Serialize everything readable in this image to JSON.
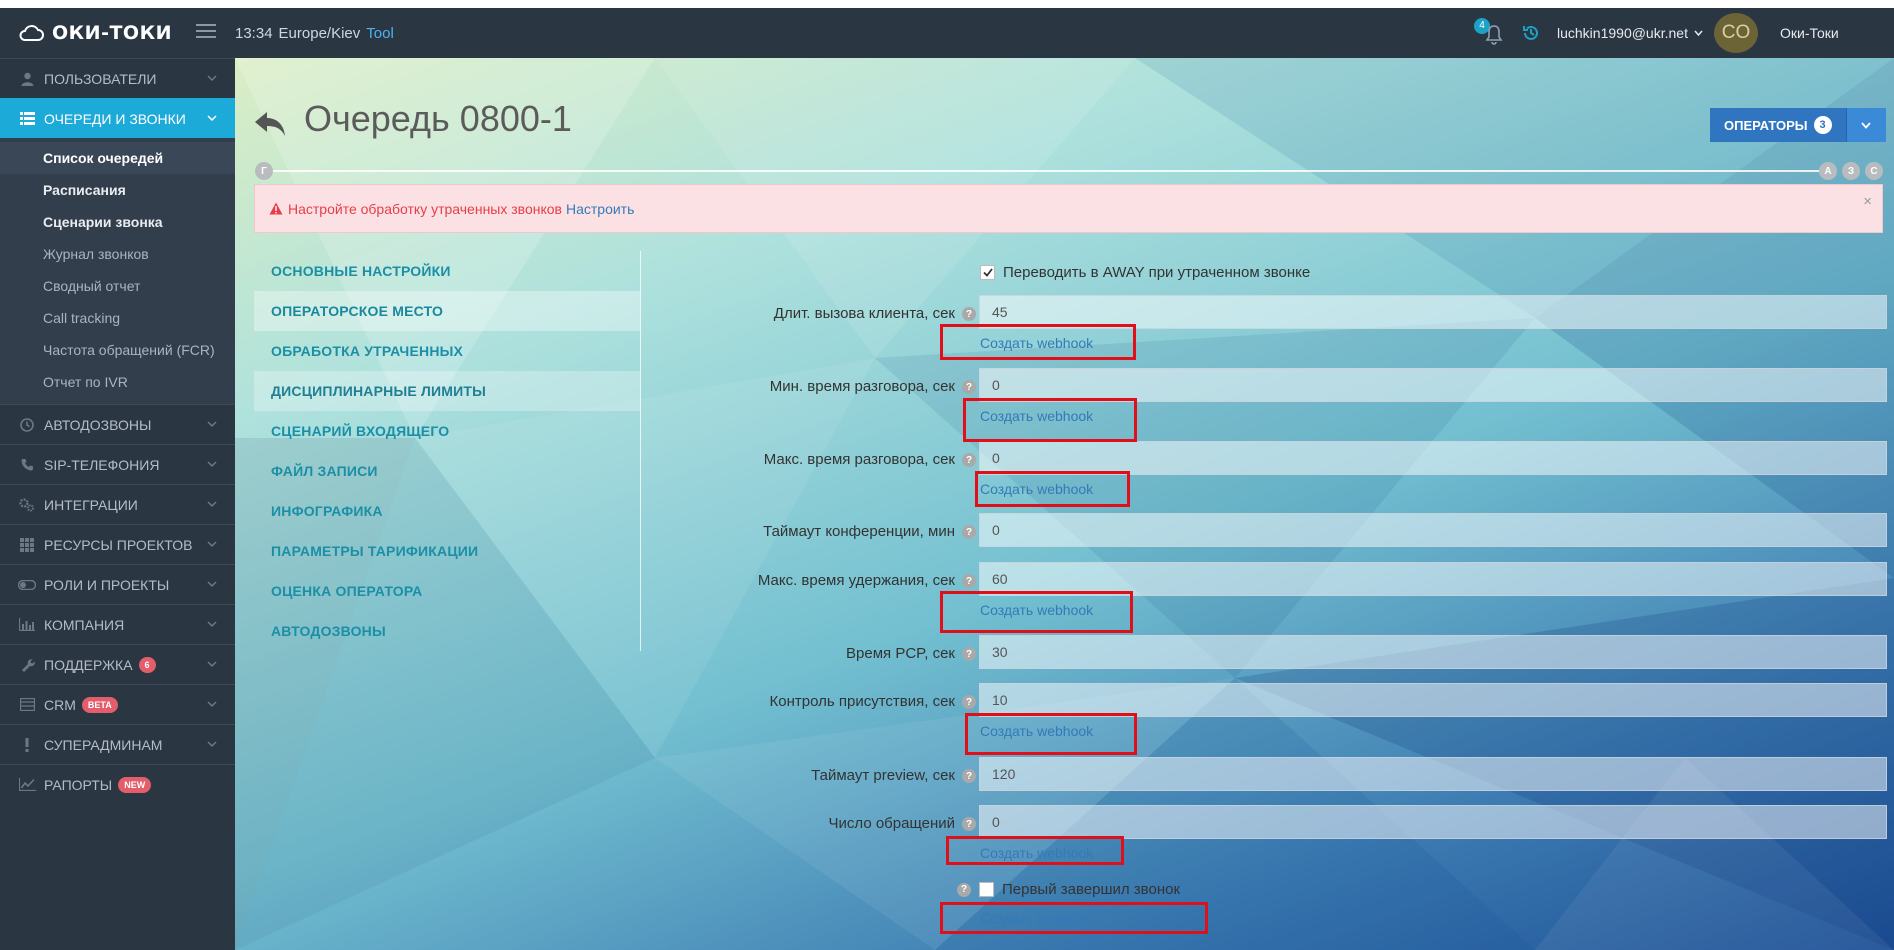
{
  "topbar": {
    "brand": "ОКИ-ТОКИ",
    "time": "13:34",
    "timezone": "Europe/Kiev",
    "tool": "Tool",
    "notifications": "4",
    "user_email": "luchkin1990@ukr.net",
    "avatar_initials": "CO",
    "user_name": "Оки-Токи"
  },
  "sidebar": {
    "items": [
      {
        "label": "ПОЛЬЗОВАТЕЛИ",
        "icon": "user-icon"
      },
      {
        "label": "ОЧЕРЕДИ И ЗВОНКИ",
        "icon": "list-icon"
      },
      {
        "label": "АВТОДОЗВОНЫ",
        "icon": "clock-icon"
      },
      {
        "label": "SIP-ТЕЛЕФОНИЯ",
        "icon": "phone-icon"
      },
      {
        "label": "ИНТЕГРАЦИИ",
        "icon": "gears-icon"
      },
      {
        "label": "РЕСУРСЫ ПРОЕКТОВ",
        "icon": "grid-icon"
      },
      {
        "label": "РОЛИ И ПРОЕКТЫ",
        "icon": "toggle-icon"
      },
      {
        "label": "КОМПАНИЯ",
        "icon": "bar-chart-icon"
      },
      {
        "label": "ПОДДЕРЖКА",
        "icon": "wrench-icon",
        "badge": "6"
      },
      {
        "label": "CRM",
        "icon": "table-icon",
        "badge": "BETA"
      },
      {
        "label": "СУПЕРАДМИНАМ",
        "icon": "exclamation-icon"
      },
      {
        "label": "РАПОРТЫ",
        "icon": "line-chart-icon",
        "badge": "NEW"
      }
    ],
    "submenu": [
      "Список очередей",
      "Расписания",
      "Сценарии звонка",
      "Журнал звонков",
      "Сводный отчет",
      "Call tracking",
      "Частота обращений (FCR)",
      "Отчет по IVR"
    ]
  },
  "main": {
    "title": "Очередь 0800-1",
    "operators_label": "ОПЕРАТОРЫ",
    "operators_count": "3",
    "timeline": {
      "start": "Г",
      "a": "А",
      "z": "З",
      "s": "С"
    },
    "alert_text": "Настройте обработку утраченных звонков",
    "alert_link": "Настроить",
    "alert_close": "×",
    "tabs": [
      "ОСНОВНЫЕ НАСТРОЙКИ",
      "ОПЕРАТОРСКОЕ МЕСТО",
      "ОБРАБОТКА УТРАЧЕННЫХ",
      "ДИСЦИПЛИНАРНЫЕ ЛИМИТЫ",
      "СЦЕНАРИЙ ВХОДЯЩЕГО",
      "ФАЙЛ ЗАПИСИ",
      "ИНФОГРАФИКА",
      "ПАРАМЕТРЫ ТАРИФИКАЦИИ",
      "ОЦЕНКА ОПЕРАТОРА",
      "АВТОДОЗВОНЫ"
    ],
    "away_checkbox": "Переводить в AWAY при утраченном звонке",
    "fields": [
      {
        "label": "Длит. вызова клиента, сек",
        "value": "45"
      },
      {
        "label": "Мин. время разговора, сек",
        "value": "0"
      },
      {
        "label": "Макс. время разговора, сек",
        "value": "0"
      },
      {
        "label": "Таймаут конференции, мин",
        "value": "0"
      },
      {
        "label": "Макс. время удержания, сек",
        "value": "60"
      },
      {
        "label": "Время PCP, сек",
        "value": "30"
      },
      {
        "label": "Контроль присутствия, сек",
        "value": "10"
      },
      {
        "label": "Таймаут preview, сек",
        "value": "120"
      },
      {
        "label": "Число обращений",
        "value": "0"
      }
    ],
    "first_finished_checkbox": "Первый завершил звонок",
    "webhook_label": "Создать webhook",
    "help_glyph": "?",
    "highlight_color": "#e0101a"
  }
}
